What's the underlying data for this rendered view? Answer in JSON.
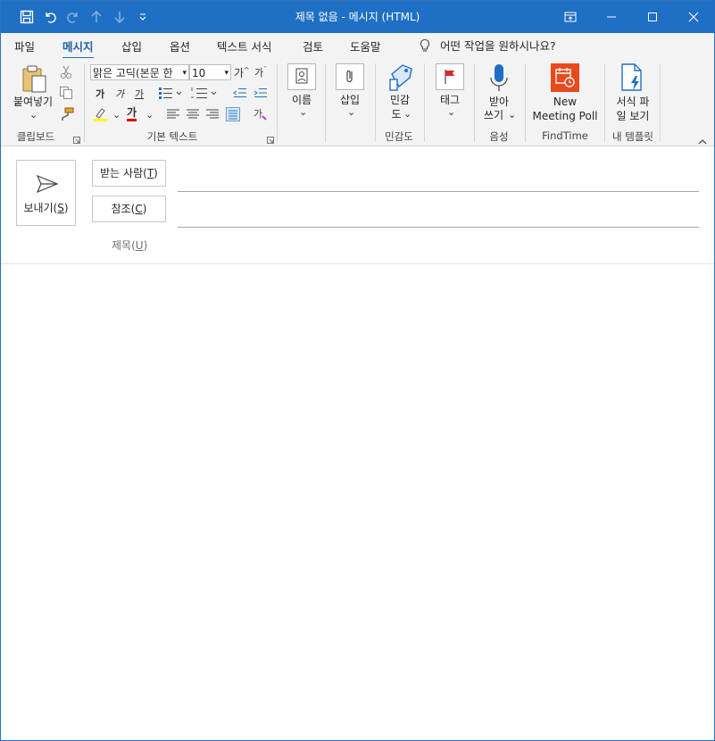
{
  "window": {
    "title": "제목 없음 - 메시지 (HTML)"
  },
  "tabs": [
    {
      "label": "파일"
    },
    {
      "label": "메시지"
    },
    {
      "label": "삽입"
    },
    {
      "label": "옵션"
    },
    {
      "label": "텍스트 서식"
    },
    {
      "label": "검토"
    },
    {
      "label": "도움말"
    }
  ],
  "tell_me": {
    "placeholder": "어떤 작업을 원하시나요?"
  },
  "ribbon": {
    "clipboard": {
      "paste_label": "붙여넣기",
      "group_label": "클립보드"
    },
    "basic_text": {
      "font_name": "맑은 고딕(본문 한",
      "font_size": "10",
      "grow_font": "가",
      "shrink_font": "가",
      "bold": "가",
      "italic": "가",
      "underline": "가",
      "font_color": "가",
      "clear_format": "가",
      "group_label": "기본 텍스트"
    },
    "names": {
      "label": "이름"
    },
    "include": {
      "label": "삽입"
    },
    "sensitivity": {
      "label_line1": "민감",
      "label_line2": "도",
      "group_label": "민감도"
    },
    "tags": {
      "label": "태그"
    },
    "voice": {
      "label_line1": "받아",
      "label_line2": "쓰기",
      "group_label": "음성"
    },
    "findtime": {
      "label_line1": "New",
      "label_line2": "Meeting Poll",
      "group_label": "FindTime"
    },
    "templates": {
      "label_line1": "서식 파",
      "label_line2": "일 보기",
      "group_label": "내 템플릿"
    }
  },
  "compose": {
    "send_label": "보내기(",
    "send_key": "S",
    "to_label": "받는 사람(",
    "to_key": "T",
    "cc_label": "참조(",
    "cc_key": "C",
    "subject_label": "제목(",
    "subject_key": "U",
    "close_paren": ")"
  },
  "colors": {
    "titlebar": "#1f6fc4",
    "accent": "#1f5fa8",
    "highlight": "#ffff00",
    "font_red": "#e00000",
    "findtime_orange": "#e8491d"
  }
}
